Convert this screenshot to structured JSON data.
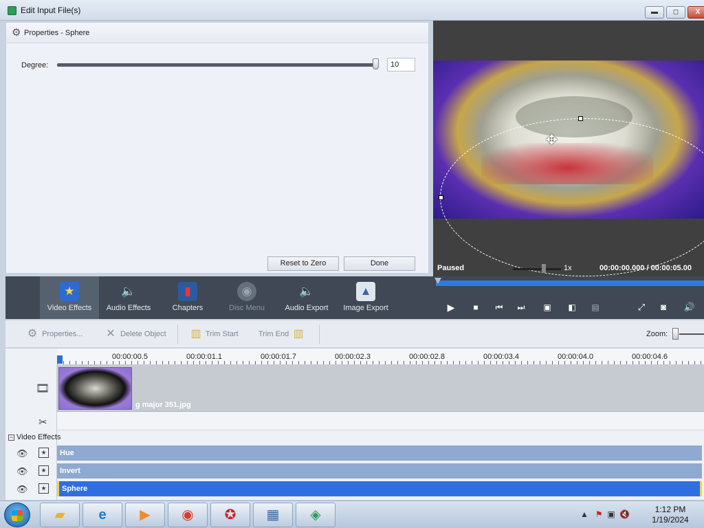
{
  "window": {
    "title": "Edit Input File(s)",
    "min": "▬",
    "max": "◻",
    "close": "X"
  },
  "properties": {
    "title": "Properties - Sphere",
    "degree_label": "Degree:",
    "degree_value": "10",
    "degree_fraction": 0.9,
    "reset_label": "Reset to Zero",
    "done_label": "Done"
  },
  "preview": {
    "status": "Paused",
    "speed": "1x",
    "current_time": "00:00:00.000",
    "separator": "/",
    "total_time": "00:00:05.00"
  },
  "toolbar": {
    "items": [
      {
        "label": "Video Effects",
        "icon": "star-icon"
      },
      {
        "label": "Audio Effects",
        "icon": "speaker-star-icon"
      },
      {
        "label": "Chapters",
        "icon": "film-bookmark-icon"
      },
      {
        "label": "Disc Menu",
        "icon": "disc-menu-icon"
      },
      {
        "label": "Audio Export",
        "icon": "speaker-export-icon"
      },
      {
        "label": "Image Export",
        "icon": "image-export-icon"
      }
    ]
  },
  "edit_tools": {
    "properties": "Properties...",
    "delete": "Delete Object",
    "trim_start": "Trim Start",
    "trim_end": "Trim End",
    "zoom": "Zoom:"
  },
  "timeline": {
    "ticks": [
      "00:00:00.5",
      "00:00:01.1",
      "00:00:01.7",
      "00:00:02.3",
      "00:00:02.8",
      "00:00:03.4",
      "00:00:04.0",
      "00:00:04.6"
    ],
    "clip_name": "g major 351.jpg",
    "effects_group": "Video Effects",
    "effects": [
      "Hue",
      "Invert",
      "Sphere"
    ]
  },
  "taskbar": {
    "time": "1:12 PM",
    "date": "1/19/2024"
  },
  "colors": {
    "accent": "#2e6ee0",
    "toolbar_bg": "#3f4854",
    "effect_bar": "#8faad0"
  }
}
